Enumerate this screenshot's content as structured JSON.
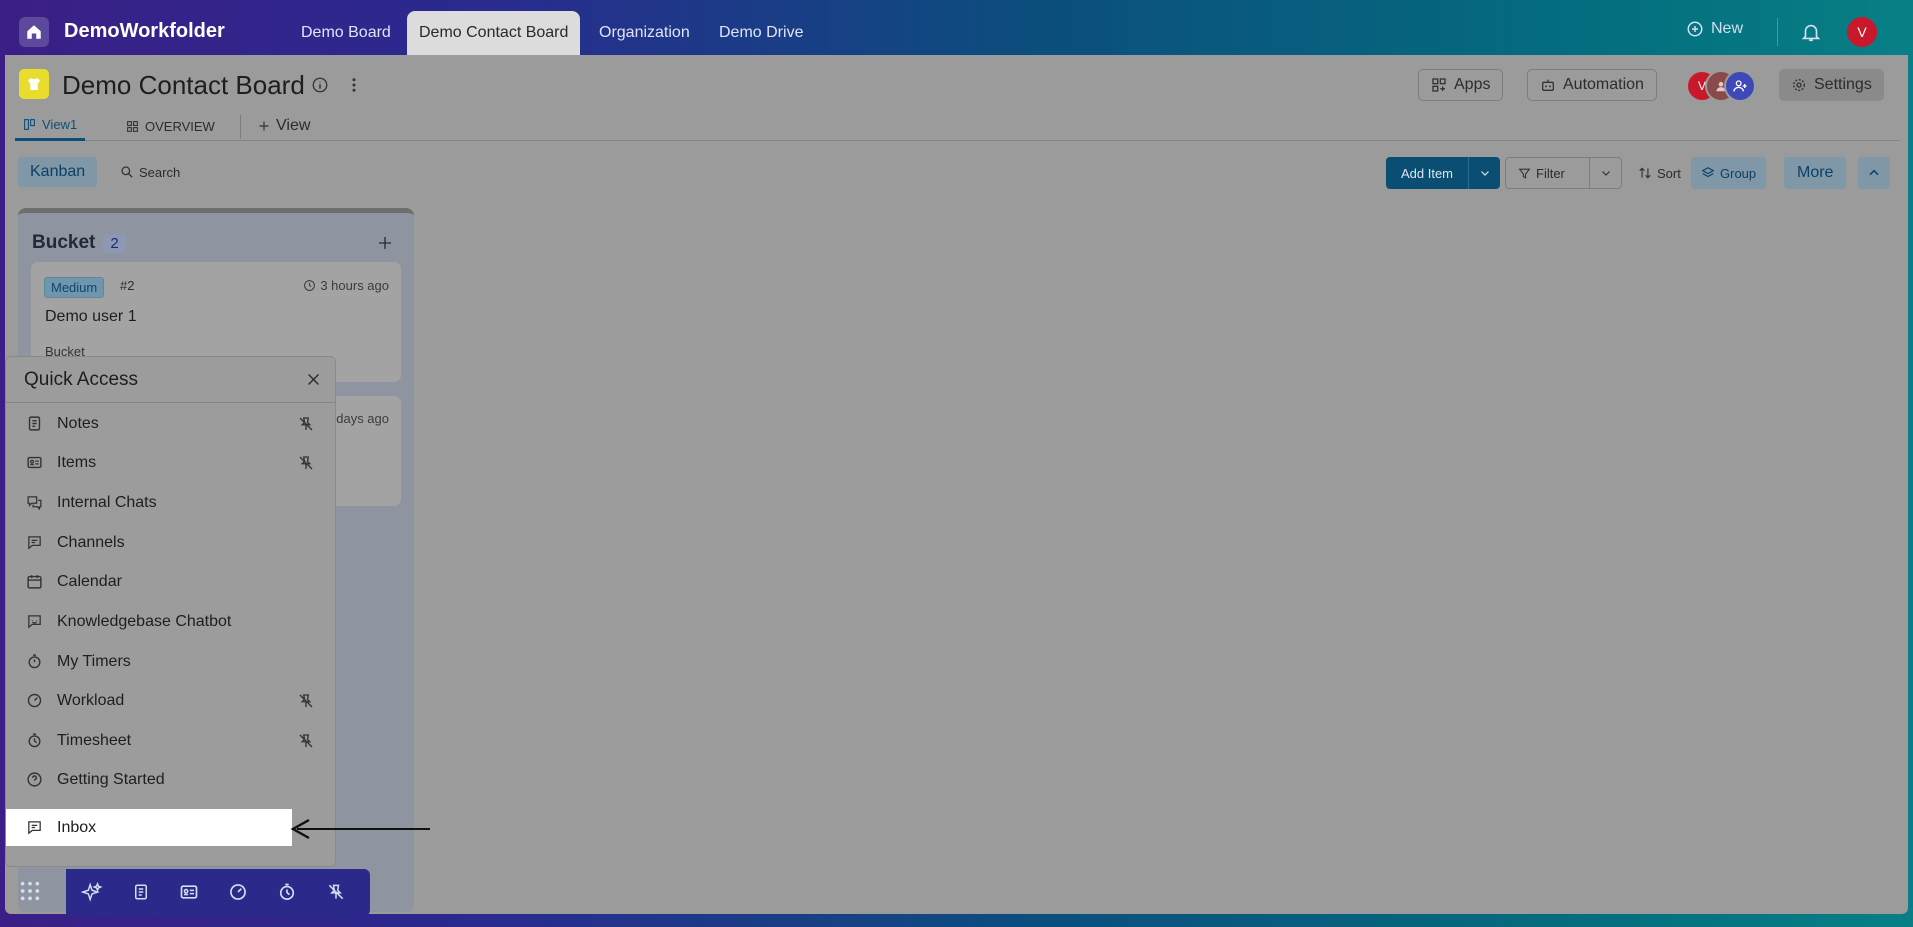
{
  "topbar": {
    "app_title": "DemoWorkfolder",
    "tabs": [
      {
        "label": "Demo Board",
        "active": false
      },
      {
        "label": "Demo Contact Board",
        "active": true
      },
      {
        "label": "Organization",
        "active": false
      },
      {
        "label": "Demo Drive",
        "active": false
      }
    ],
    "new_label": "New",
    "user_initial": "V"
  },
  "board": {
    "title": "Demo Contact Board",
    "apps_label": "Apps",
    "automation_label": "Automation",
    "settings_label": "Settings",
    "member_initial": "V"
  },
  "views": {
    "tabs": [
      {
        "label": "View1",
        "active": true
      },
      {
        "label": "OVERVIEW",
        "active": false
      }
    ],
    "add_view_label": "View"
  },
  "toolbar": {
    "kanban_label": "Kanban",
    "search_label": "Search",
    "add_item_label": "Add Item",
    "filter_label": "Filter",
    "sort_label": "Sort",
    "group_label": "Group",
    "more_label": "More"
  },
  "column": {
    "title": "Bucket",
    "count": "2",
    "cards": [
      {
        "priority": "Medium",
        "number": "#2",
        "time": "3 hours ago",
        "name": "Demo user 1",
        "bucket": "Bucket"
      },
      {
        "time": "days ago"
      }
    ]
  },
  "quick_access": {
    "title": "Quick Access",
    "items": [
      {
        "label": "Notes",
        "icon": "notes-icon",
        "pinned": true
      },
      {
        "label": "Items",
        "icon": "items-icon",
        "pinned": true
      },
      {
        "label": "Internal Chats",
        "icon": "chats-icon",
        "pinned": false
      },
      {
        "label": "Channels",
        "icon": "channels-icon",
        "pinned": false
      },
      {
        "label": "Calendar",
        "icon": "calendar-icon",
        "pinned": false
      },
      {
        "label": "Knowledgebase Chatbot",
        "icon": "chatbot-icon",
        "pinned": false
      },
      {
        "label": "My Timers",
        "icon": "timer-icon",
        "pinned": false
      },
      {
        "label": "Workload",
        "icon": "workload-icon",
        "pinned": true
      },
      {
        "label": "Timesheet",
        "icon": "timesheet-icon",
        "pinned": true
      },
      {
        "label": "Getting Started",
        "icon": "help-icon",
        "pinned": false
      },
      {
        "label": "Inbox",
        "icon": "inbox-icon",
        "pinned": false,
        "highlighted": true
      }
    ]
  },
  "colors": {
    "accent": "#0b4e73",
    "avatar_red": "#c8182b",
    "board_icon_yellow": "#e8dc2d"
  }
}
